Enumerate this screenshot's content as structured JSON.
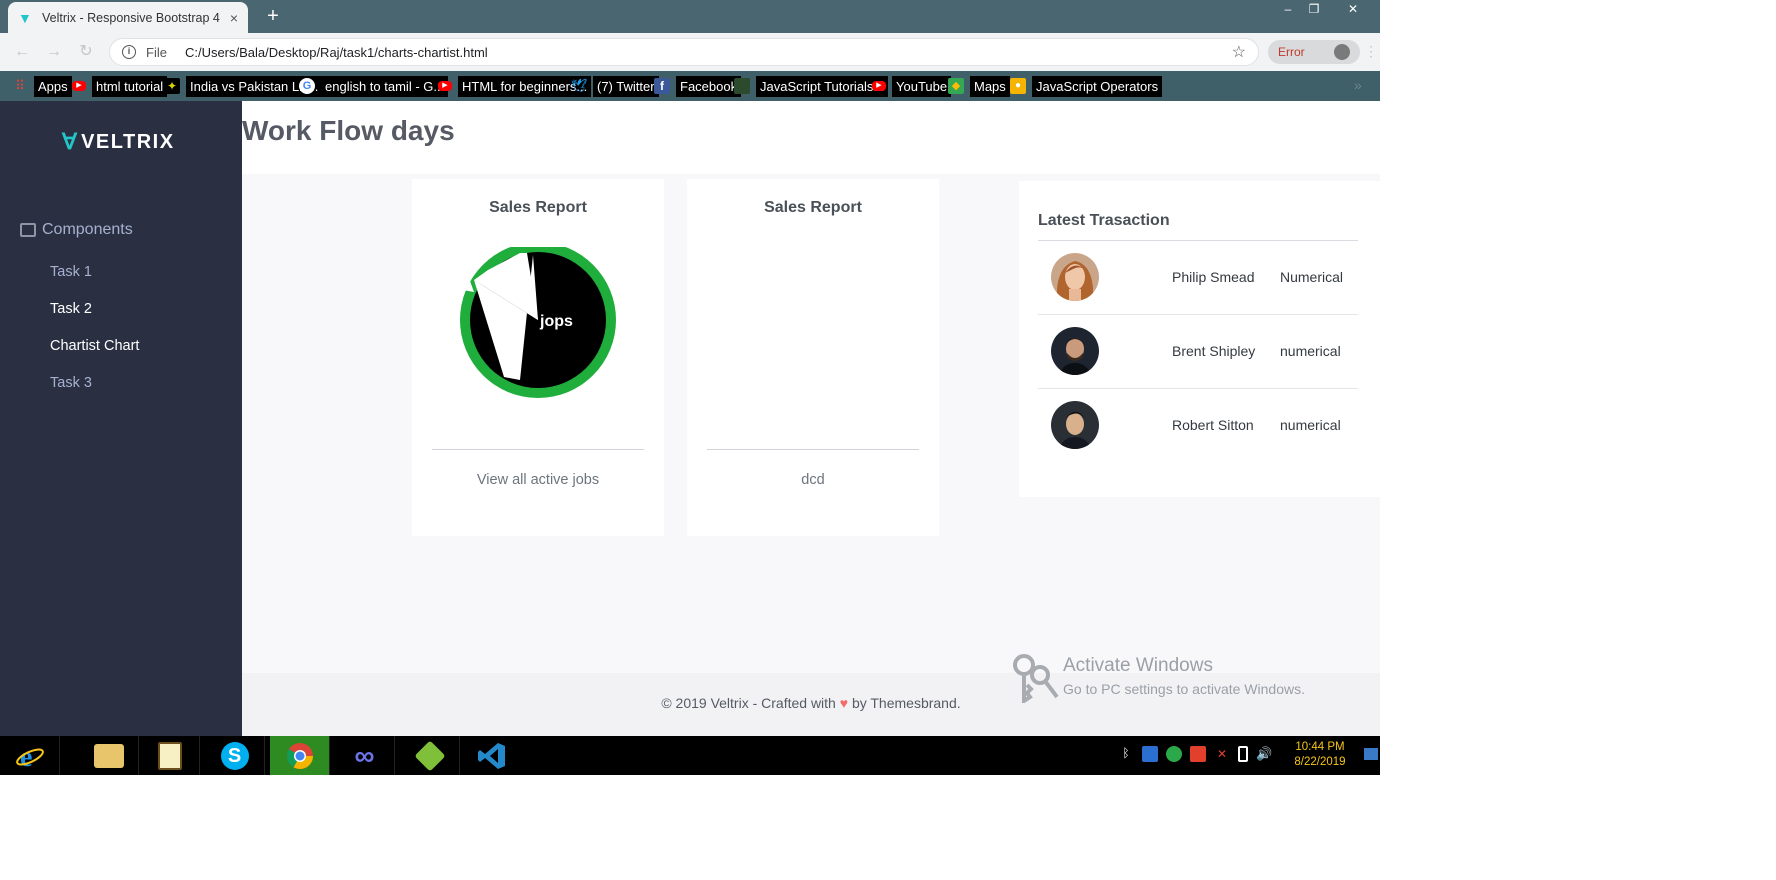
{
  "browser": {
    "tab_title": "Veltrix - Responsive Bootstrap 4 ...",
    "tab_close": "×",
    "new_tab": "+",
    "window": {
      "minimize": "–",
      "restore": "❐",
      "close": "✕"
    },
    "address_scheme": "File",
    "address_url": "C:/Users/Bala/Desktop/Raj/task1/charts-chartist.html",
    "profile_status": "Error",
    "bookmarks": [
      {
        "label": "Apps",
        "icon": "apps-grid-icon"
      },
      {
        "label": "html tutorial",
        "icon": "youtube-icon"
      },
      {
        "label": "India vs Pakistan Liv...",
        "icon": "site-icon"
      },
      {
        "label": "english to tamil - G...",
        "icon": "google-icon"
      },
      {
        "label": "HTML for beginners...",
        "icon": "youtube-icon"
      },
      {
        "label": "(7) Twitter",
        "icon": "twitter-icon"
      },
      {
        "label": "Facebook",
        "icon": "facebook-icon"
      },
      {
        "label": "JavaScript Tutorials...",
        "icon": "site-icon"
      },
      {
        "label": "YouTube",
        "icon": "youtube-icon"
      },
      {
        "label": "Maps",
        "icon": "maps-icon"
      },
      {
        "label": "JavaScript Operators",
        "icon": "site-icon"
      }
    ],
    "bookmarks_overflow": "»"
  },
  "sidebar": {
    "logo_text": "VELTRIX",
    "section_label": "Components",
    "items": [
      {
        "label": "Task 1"
      },
      {
        "label": "Task 2"
      },
      {
        "label": "Chartist Chart"
      },
      {
        "label": "Task 3"
      }
    ]
  },
  "header": {
    "title": "Work Flow days"
  },
  "cards": [
    {
      "title": "Sales Report",
      "chart_label": "jops",
      "footer": "View all active jobs"
    },
    {
      "title": "Sales Report",
      "footer": "dcd"
    }
  ],
  "chart_data": {
    "type": "pie",
    "title": "Sales Report",
    "annotation": "jops",
    "colors": {
      "ring": "#1fae3b",
      "slice": "#000000",
      "gap": "#ffffff"
    }
  },
  "transactions": {
    "title": "Latest Trasaction",
    "rows": [
      {
        "name": "Philip Smead",
        "type": "Numerical"
      },
      {
        "name": "Brent Shipley",
        "type": "numerical"
      },
      {
        "name": "Robert Sitton",
        "type": "numerical"
      }
    ]
  },
  "footer": {
    "copyright_prefix": "© 2019 Veltrix - Crafted with",
    "heart": "♥",
    "copyright_suffix": "by Themesbrand."
  },
  "windows_watermark": {
    "line1": "Activate Windows",
    "line2": "Go to PC settings to activate Windows."
  },
  "taskbar": {
    "apps": [
      "internet-explorer-icon",
      "file-explorer-icon",
      "notepad-icon",
      "skype-icon",
      "chrome-icon",
      "infinity-app-icon",
      "netbeans-icon",
      "vscode-icon"
    ],
    "time": "10:44 PM",
    "date": "8/22/2019"
  },
  "colors": {
    "accent": "#23c6c8",
    "sidebar_bg": "#2a3042",
    "chart_green": "#1fae3b",
    "heart": "#f46a6a",
    "taskbar_active": "#2e8b22"
  }
}
